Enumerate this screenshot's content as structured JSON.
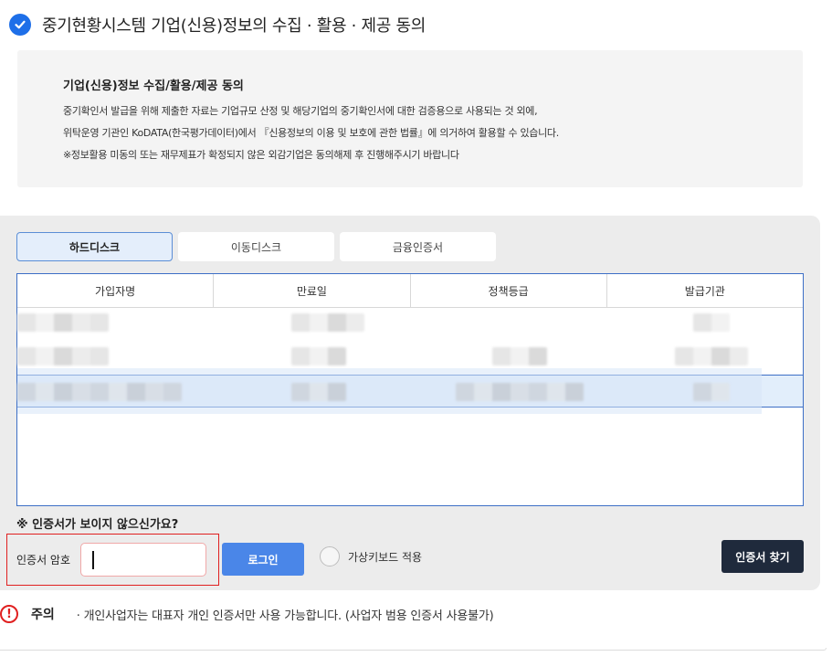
{
  "header": {
    "title": "중기현황시스템 기업(신용)정보의 수집 · 활용 · 제공 동의"
  },
  "consent": {
    "heading": "기업(신용)정보 수집/활용/제공 동의",
    "lines": [
      "중기확인서 발급을 위해 제출한 자료는 기업규모 산정 및 해당기업의 중기확인서에 대한 검증용으로 사용되는 것 외에,",
      "위탁운영 기관인 KoDATA(한국평가데이터)에서 『신용정보의 이용 및 보호에 관한 법률』에 의거하여 활용할 수 있습니다.",
      "※정보활용 미동의 또는 재무제표가 확정되지 않은 외감기업은 동의해제 후 진행해주시기 바랍니다"
    ]
  },
  "cert_panel": {
    "tabs": [
      {
        "label": "하드디스크",
        "active": true
      },
      {
        "label": "이동디스크",
        "active": false
      },
      {
        "label": "금융인증서",
        "active": false
      }
    ],
    "table": {
      "columns": [
        "가입자명",
        "만료일",
        "정책등급",
        "발급기관"
      ]
    },
    "missing_cert_question": "※ 인증서가 보이지 않으신가요?",
    "password_label": "인증서 암호",
    "password_value": "",
    "login_button": "로그인",
    "virtual_keyboard_label": "가상키보드 적용",
    "virtual_keyboard_checked": false,
    "find_cert_button": "인증서 찾기"
  },
  "notice": {
    "icon": "exclamation-circle-icon",
    "title": "주의",
    "text": "· 개인사업자는 대표자 개인 인증서만 사용 가능합니다. (사업자 범용 인증서 사용불가)"
  },
  "colors": {
    "accent": "#1e6fe8",
    "login": "#4a86e8",
    "find": "#1f2a3c",
    "warning": "#e02020"
  }
}
